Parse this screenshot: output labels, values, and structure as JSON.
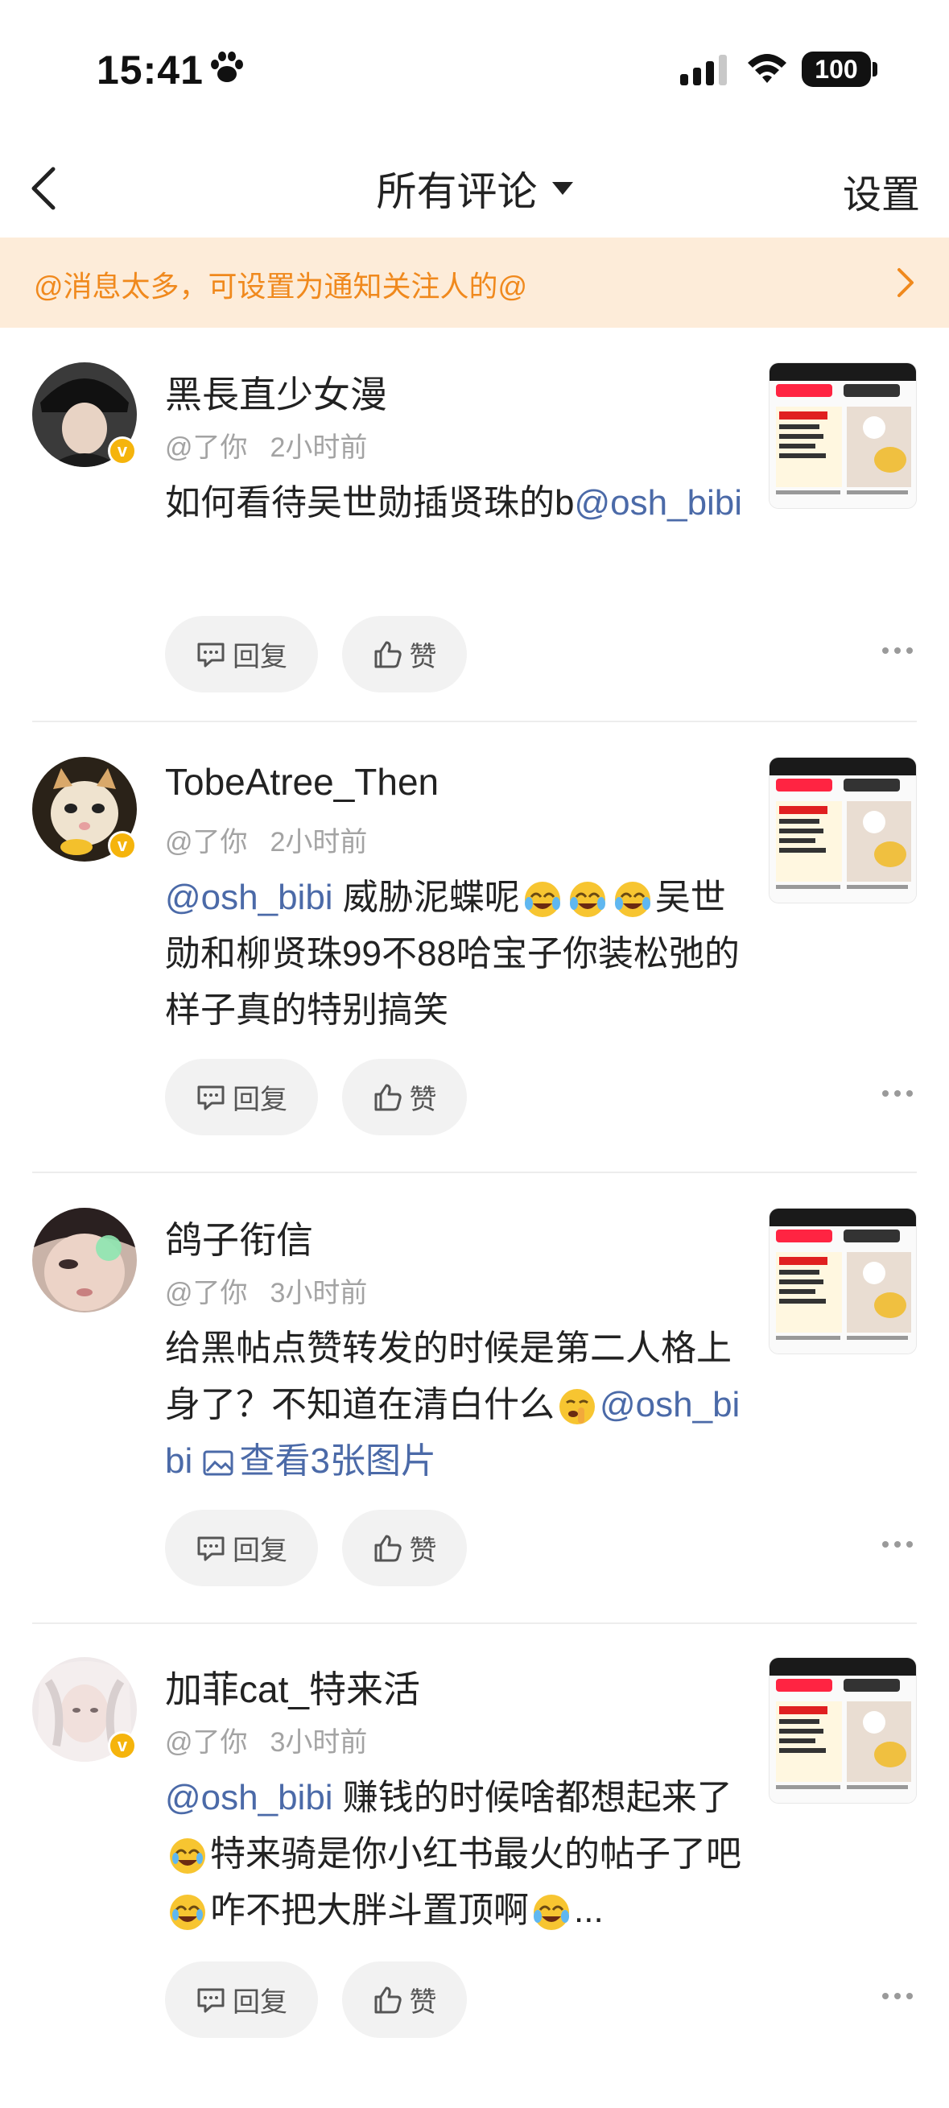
{
  "status": {
    "time": "15:41",
    "battery": "100"
  },
  "nav": {
    "title": "所有评论",
    "settings": "设置"
  },
  "banner": {
    "text": "@消息太多，可设置为通知关注人的@"
  },
  "actions": {
    "reply": "回复",
    "like": "赞"
  },
  "comments": [
    {
      "username": "黑長直少女漫",
      "meta_action": "@了你",
      "time": "2小时前",
      "text_before": "如何看待吴世勋插贤珠的b",
      "mention": "@osh_bibi",
      "verified": true
    },
    {
      "username": "TobeAtree_Then",
      "meta_action": "@了你",
      "time": "2小时前",
      "mention": "@osh_bibi",
      "text_part1": " 威胁泥蝶呢",
      "text_part2": "吴世勋和柳贤珠99不88哈宝子你装松弛的样子真的特别搞笑",
      "verified": true
    },
    {
      "username": "鸽子衔信",
      "meta_action": "@了你",
      "time": "3小时前",
      "text_part1": "给黑帖点赞转发的时候是第二人格上身了？不知道在清白什么",
      "mention": "@osh_bibi",
      "image_link": "查看3张图片",
      "verified": false
    },
    {
      "username": "加菲cat_特来活",
      "meta_action": "@了你",
      "time": "3小时前",
      "mention": "@osh_bibi",
      "text_part1": " 赚钱的时候啥都想起来了",
      "text_part2": "特来骑是你小红书最火的帖子了吧",
      "text_part3": "咋不把大胖斗置顶啊",
      "ellipsis": "...",
      "verified": true
    }
  ]
}
